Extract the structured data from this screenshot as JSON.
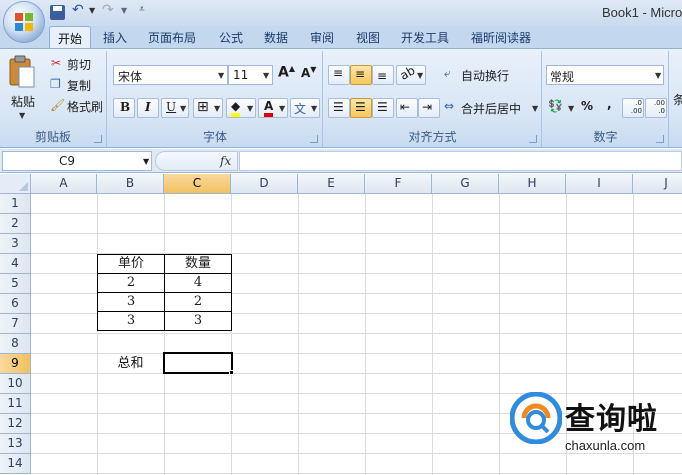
{
  "window": {
    "title": "Book1 - Micro"
  },
  "tabs": [
    "开始",
    "插入",
    "页面布局",
    "公式",
    "数据",
    "审阅",
    "视图",
    "开发工具",
    "福昕阅读器"
  ],
  "clipboard": {
    "paste_label": "粘贴",
    "cut_label": "剪切",
    "copy_label": "复制",
    "format_painter_label": "格式刷",
    "group_label": "剪贴板"
  },
  "font": {
    "name": "宋体",
    "size": "11",
    "bold": "B",
    "italic": "I",
    "underline": "U",
    "color_glyph": "A",
    "group_label": "字体"
  },
  "alignment": {
    "wrap_text_label": "自动换行",
    "merge_center_label": "合并后居中",
    "group_label": "对齐方式"
  },
  "number": {
    "format": "常规",
    "percent": "%",
    "comma": ",",
    "inc_decimal": ".0 .00",
    "dec_decimal": ".00 .0",
    "group_label": "数字"
  },
  "styles": {
    "partial_label": "条"
  },
  "formula_bar": {
    "name_box": "C9",
    "fx": "fx",
    "formula": ""
  },
  "columns": [
    "A",
    "B",
    "C",
    "D",
    "E",
    "F",
    "G",
    "H",
    "I",
    "J"
  ],
  "rows": [
    "1",
    "2",
    "3",
    "4",
    "5",
    "6",
    "7",
    "8",
    "9",
    "10",
    "11",
    "12",
    "13",
    "14"
  ],
  "selection": {
    "column": "C",
    "row": "9"
  },
  "table": {
    "headers": [
      "单价",
      "数量"
    ],
    "rows": [
      [
        "2",
        "4"
      ],
      [
        "3",
        "2"
      ],
      [
        "3",
        "3"
      ]
    ]
  },
  "sum_label": "总和",
  "watermark": {
    "text": "查询啦",
    "url": "chaxunla.com"
  }
}
